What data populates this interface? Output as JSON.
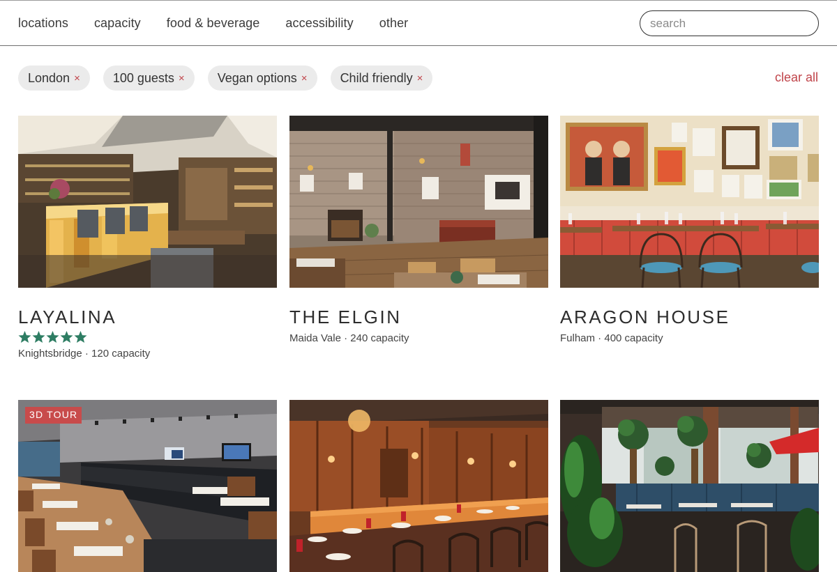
{
  "nav": {
    "items": [
      "locations",
      "capacity",
      "food & beverage",
      "accessibility",
      "other"
    ],
    "search_placeholder": "search"
  },
  "filters": {
    "chips": [
      {
        "label": "London"
      },
      {
        "label": "100 guests"
      },
      {
        "label": "Vegan options"
      },
      {
        "label": "Child friendly"
      }
    ],
    "remove_symbol": "×",
    "clear_all": "clear all"
  },
  "colors": {
    "accent": "#c0444a",
    "star": "#2e7d63",
    "chip_bg": "#ebebeb"
  },
  "venues": [
    {
      "name": "LAYALINA",
      "area": "Knightsbridge",
      "capacity": "120 capacity",
      "meta": "Knightsbridge · 120 capacity",
      "rating": 5,
      "photo": "restaurant-bar-interior"
    },
    {
      "name": "THE ELGIN",
      "area": "Maida Vale",
      "capacity": "240 capacity",
      "meta": "Maida Vale · 240 capacity",
      "photo": "brick-wall-pub-interior"
    },
    {
      "name": "ARAGON HOUSE",
      "area": "Fulham",
      "capacity": "400 capacity",
      "meta": "Fulham · 400 capacity",
      "photo": "red-banquette-gallery-room"
    },
    {
      "badge": "3D TOUR",
      "photo": "long-dining-room-with-tvs"
    },
    {
      "photo": "wood-panelled-dining-room"
    },
    {
      "photo": "blue-banquette-plant-room"
    }
  ]
}
